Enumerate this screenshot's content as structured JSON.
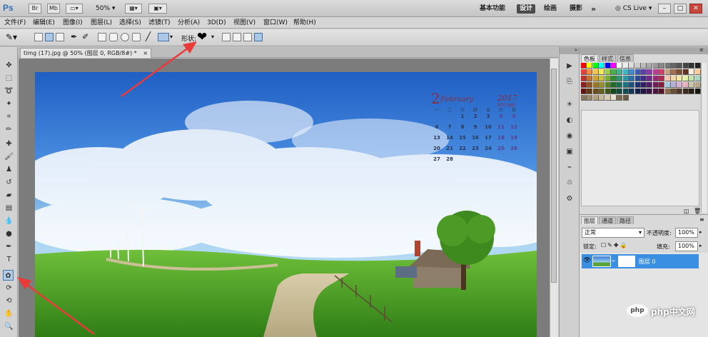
{
  "app": {
    "logo": "Ps",
    "bridge_btn": "Br",
    "mini_btn": "Mb",
    "zoom": "50%",
    "workspaces": [
      "基本功能",
      "设计",
      "绘画",
      "摄影"
    ],
    "more": "»",
    "cslive": "CS Live",
    "window_btns": [
      "–",
      "□",
      "✕"
    ]
  },
  "menus": [
    "文件(F)",
    "编辑(E)",
    "图像(I)",
    "图层(L)",
    "选择(S)",
    "滤镜(T)",
    "分析(A)",
    "3D(D)",
    "视图(V)",
    "窗口(W)",
    "帮助(H)"
  ],
  "options": {
    "shape_label": "形状:",
    "shape_glyph": "❤"
  },
  "document": {
    "tab_title": "timg (17).jpg @ 50% (图层 0, RGB/8#) *",
    "close": "×"
  },
  "calendar": {
    "day": "2",
    "month": "February",
    "year": "2017",
    "subtitle": "农历丁酉年",
    "weekdays": [
      "一",
      "二",
      "三",
      "四",
      "五",
      "六",
      "日"
    ],
    "rows": [
      [
        "",
        "",
        "1",
        "2",
        "3",
        "4",
        "5"
      ],
      [
        "6",
        "7",
        "8",
        "9",
        "10",
        "11",
        "12"
      ],
      [
        "13",
        "14",
        "15",
        "16",
        "17",
        "18",
        "19"
      ],
      [
        "20",
        "21",
        "22",
        "23",
        "24",
        "25",
        "26"
      ],
      [
        "27",
        "28",
        "",
        "",
        "",
        "",
        ""
      ]
    ]
  },
  "panels": {
    "swatch_tabs": [
      "色板",
      "样式",
      "信息"
    ],
    "layer_tabs": [
      "图层",
      "通道",
      "路径"
    ],
    "blend_mode": "正常",
    "opacity_label": "不透明度:",
    "opacity": "100%",
    "lock_label": "锁定:",
    "fill_label": "填充:",
    "fill": "100%",
    "layer_name": "图层 0"
  },
  "watermark": {
    "text": "php中文网",
    "logo": "php"
  },
  "colors": {
    "accent": "#3b8fe3",
    "arrow": "#ea3a3a"
  }
}
